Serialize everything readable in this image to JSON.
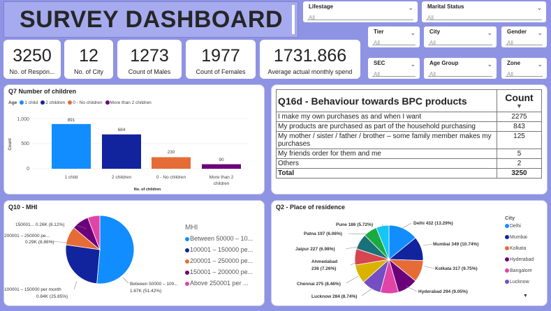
{
  "header": {
    "title": "SURVEY DASHBOARD"
  },
  "slicers": {
    "lifestage": {
      "label": "Lifestage",
      "value": "All"
    },
    "marital_status": {
      "label": "Marital Status",
      "value": "All"
    },
    "tier": {
      "label": "Tier",
      "value": "All"
    },
    "city": {
      "label": "City",
      "value": "All"
    },
    "gender": {
      "label": "Gender",
      "value": "All"
    },
    "sec": {
      "label": "SEC",
      "value": "All"
    },
    "age_group": {
      "label": "Age Group",
      "value": "All"
    },
    "zone": {
      "label": "Zone",
      "value": "All"
    }
  },
  "kpis": [
    {
      "value": "3250",
      "caption": "No. of Respon..."
    },
    {
      "value": "12",
      "caption": "No. of City"
    },
    {
      "value": "1273",
      "caption": "Count of Males"
    },
    {
      "value": "1977",
      "caption": "Count of Females"
    },
    {
      "value": "1731.866",
      "caption": "Average actual monthly spend"
    }
  ],
  "q7": {
    "title": "Q7 Number of children",
    "legend_title": "Age",
    "legend": [
      "1 child",
      "2 children",
      "0 - No children",
      "More than 2 children"
    ],
    "ytick": [
      "1,000",
      "500",
      "0"
    ],
    "ylabel": "Count",
    "xlabel": "No. of children",
    "cat1": "1 child",
    "cat2": "2 children",
    "cat3": "0 - No children",
    "cat4a": "More than 2",
    "cat4b": "children",
    "lbl1": "891",
    "lbl2": "684",
    "lbl3": "230",
    "lbl4": "90"
  },
  "q16d": {
    "title": "Q16d - Behaviour towards BPC products",
    "count_header": "Count",
    "rows": [
      {
        "label": "I make my own purchases as and when I want",
        "count": "2275"
      },
      {
        "label": "My products are purchased as part of the household purchasing",
        "count": "843"
      },
      {
        "label": "My mother / sister / father / brother – some family member makes my purchases",
        "count": "125"
      },
      {
        "label": "My friends order for them and me",
        "count": "5"
      },
      {
        "label": "Others",
        "count": "2"
      }
    ],
    "total_label": "Total",
    "total": "3250"
  },
  "q10": {
    "title": "Q10 - MHI",
    "legend_title": "MHI",
    "legend": [
      "Between 50000 – 10...",
      "100001 – 150000 pe...",
      "200001 – 250000 pe...",
      "150001 – 200000 pe...",
      "Above 250001 per ..."
    ],
    "lbl_top1": "150001... 0.26K (8.12%)",
    "lbl_top2a": "200001 – 250000 pe...",
    "lbl_top2b": "0.29K (8.86%)",
    "lbl_left_a": "100001 – 150000 per month",
    "lbl_left_b": "0.84K (25.85%)",
    "lbl_right_a": "Between 50000 – 100...",
    "lbl_right_b": "1.67K (51.42%)"
  },
  "q2": {
    "title": "Q2 - Place of residence",
    "legend_title": "City",
    "legend": [
      "Delhi",
      "Mumbai",
      "Kolkata",
      "Hyderabad",
      "Bangalore",
      "Lucknow"
    ],
    "labels": {
      "pune": "Pune 186 (5.72%)",
      "patna": "Patna 197 (6.06%)",
      "jaipur": "Jaipur 227 (6.98%)",
      "ahmedabad_a": "Ahmedabad",
      "ahmedabad_b": "236 (7.26%)",
      "chennai": "Chennai 275 (8.46%)",
      "lucknow": "Lucknow 284 (8.74%)",
      "delhi": "Delhi 432 (13.29%)",
      "mumbai": "Mumbai 349 (10.74%)",
      "kolkata": "Kolkata 317 (9.75%)",
      "hyderabad": "Hyderabad 294 (9.05%)"
    }
  },
  "chart_data": [
    {
      "type": "bar",
      "title": "Q7 Number of children",
      "categories": [
        "1 child",
        "2 children",
        "0 - No children",
        "More than 2 children"
      ],
      "values": [
        891,
        684,
        230,
        90
      ],
      "xlabel": "No. of children",
      "ylabel": "Count",
      "ylim": [
        0,
        1000
      ],
      "colors": [
        "#118dff",
        "#12239e",
        "#e66c37",
        "#6b007b"
      ]
    },
    {
      "type": "pie",
      "title": "Q10 - MHI",
      "categories": [
        "Between 50000 – 100000 per month",
        "100001 – 150000 per month",
        "200001 – 250000 per month",
        "150001 – 200000 per month",
        "Above 250001 per month"
      ],
      "values": [
        1671,
        840,
        288,
        264,
        187
      ],
      "percent": [
        51.42,
        25.85,
        8.86,
        8.12,
        5.75
      ],
      "colors": [
        "#118dff",
        "#12239e",
        "#e66c37",
        "#6b007b",
        "#e044a7"
      ]
    },
    {
      "type": "pie",
      "title": "Q2 - Place of residence",
      "categories": [
        "Delhi",
        "Mumbai",
        "Kolkata",
        "Hyderabad",
        "Bangalore",
        "Lucknow",
        "Chennai",
        "Ahmedabad",
        "Jaipur",
        "Patna",
        "Pune"
      ],
      "values": [
        432,
        349,
        317,
        294,
        262,
        284,
        275,
        236,
        227,
        197,
        186
      ],
      "colors": [
        "#118dff",
        "#12239e",
        "#e66c37",
        "#6b007b",
        "#e044a7",
        "#744ec2",
        "#d9b300",
        "#d64550",
        "#197278",
        "#1aab40",
        "#15c6f4"
      ]
    }
  ]
}
